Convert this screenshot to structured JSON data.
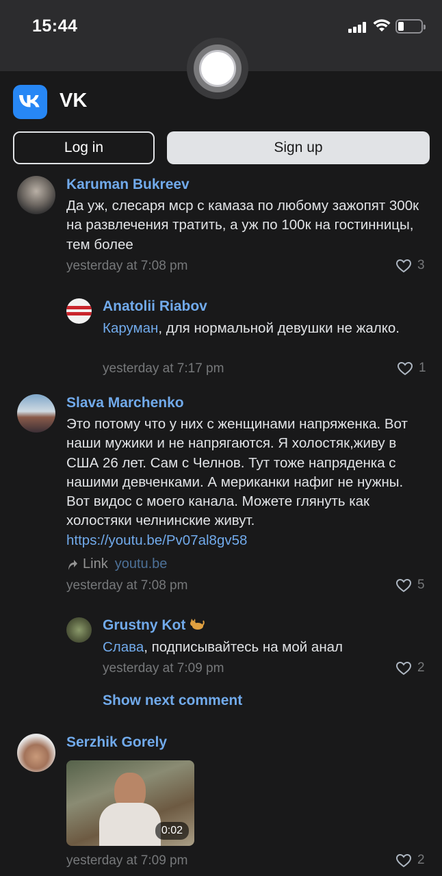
{
  "status_bar": {
    "time": "15:44"
  },
  "header": {
    "app_name": "VK",
    "login_label": "Log in",
    "signup_label": "Sign up"
  },
  "colors": {
    "accent": "#71aaeb",
    "brand": "#2787f5",
    "background": "#19191a"
  },
  "comments": [
    {
      "author": "Karuman Bukreev",
      "text": "Да уж, слесаря мср с камаза по любому зажопят 300к на развлечения тратить, а уж по 100к на гостинницы, тем более",
      "time": "yesterday at 7:08 pm",
      "likes": "3"
    },
    {
      "author": "Anatolii Riabov",
      "mention": "Каруман",
      "text": ", для нормальной девушки не жалко.",
      "time": "yesterday at 7:17 pm",
      "likes": "1"
    },
    {
      "author": "Slava Marchenko",
      "text": "Это потому что у них с женщинами напряженка. Вот наши мужики и не напрягаются. Я холостяк,живу в США 26 лет. Сам с Челнов. Тут тоже напряденка с нашими девченками. А мериканки нафиг не нужны. Вот видос с моего канала. Можете глянуть как холостяки челнинские живут. ",
      "url": "https://youtu.be/Pv07al8gv58",
      "link_label": "Link",
      "link_domain": "youtu.be",
      "time": "yesterday at 7:08 pm",
      "likes": "5"
    },
    {
      "author": "Grustny Kot",
      "mention": "Слава",
      "text": ", подписывайтесь на мой анал",
      "time": "yesterday at 7:09 pm",
      "likes": "2"
    },
    {
      "author": "Serzhik Gorely",
      "video_duration": "0:02",
      "time": "yesterday at 7:09 pm",
      "likes": "2"
    }
  ],
  "show_next_label": "Show next comment"
}
